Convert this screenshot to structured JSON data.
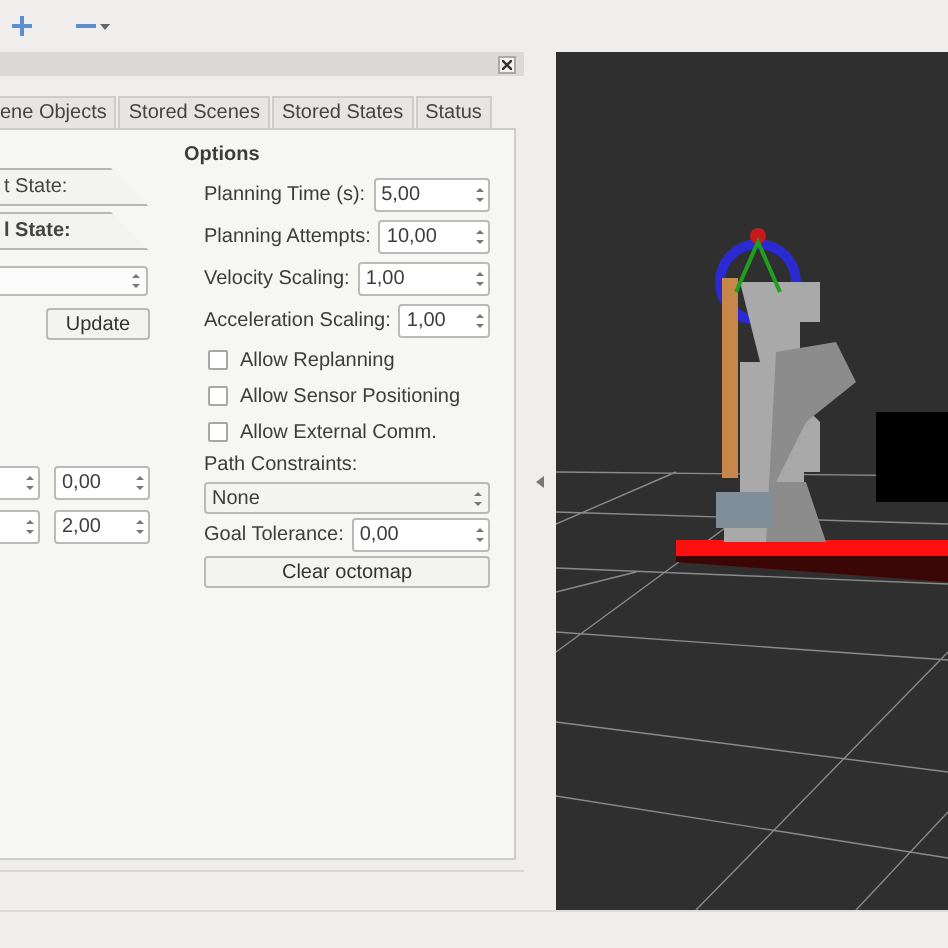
{
  "panel": {
    "tabs": [
      {
        "label": "ene Objects",
        "selected": false
      },
      {
        "label": "Stored Scenes",
        "selected": false
      },
      {
        "label": "Stored States",
        "selected": false
      },
      {
        "label": "Status",
        "selected": false
      }
    ],
    "state_tabs": [
      {
        "label": "t State:",
        "selected": false
      },
      {
        "label": "l State:",
        "selected": true
      }
    ],
    "update_button": "Update",
    "spin_rows": [
      {
        "value": "0,00"
      },
      {
        "value": "2,00"
      }
    ],
    "options": {
      "title": "Options",
      "spins": [
        {
          "label": "Planning Time (s):",
          "value": "5,00"
        },
        {
          "label": "Planning Attempts:",
          "value": "10,00"
        },
        {
          "label": "Velocity Scaling:",
          "value": "1,00"
        },
        {
          "label": "Acceleration Scaling:",
          "value": "1,00"
        }
      ],
      "checkboxes": [
        {
          "label": "Allow Replanning",
          "checked": false
        },
        {
          "label": "Allow Sensor Positioning",
          "checked": false
        },
        {
          "label": "Allow External Comm.",
          "checked": false
        }
      ],
      "path_constraints_label": "Path Constraints:",
      "path_constraints_value": "None",
      "goal_tolerance": {
        "label": "Goal Tolerance:",
        "value": "0,00"
      },
      "clear_button": "Clear octomap"
    }
  }
}
